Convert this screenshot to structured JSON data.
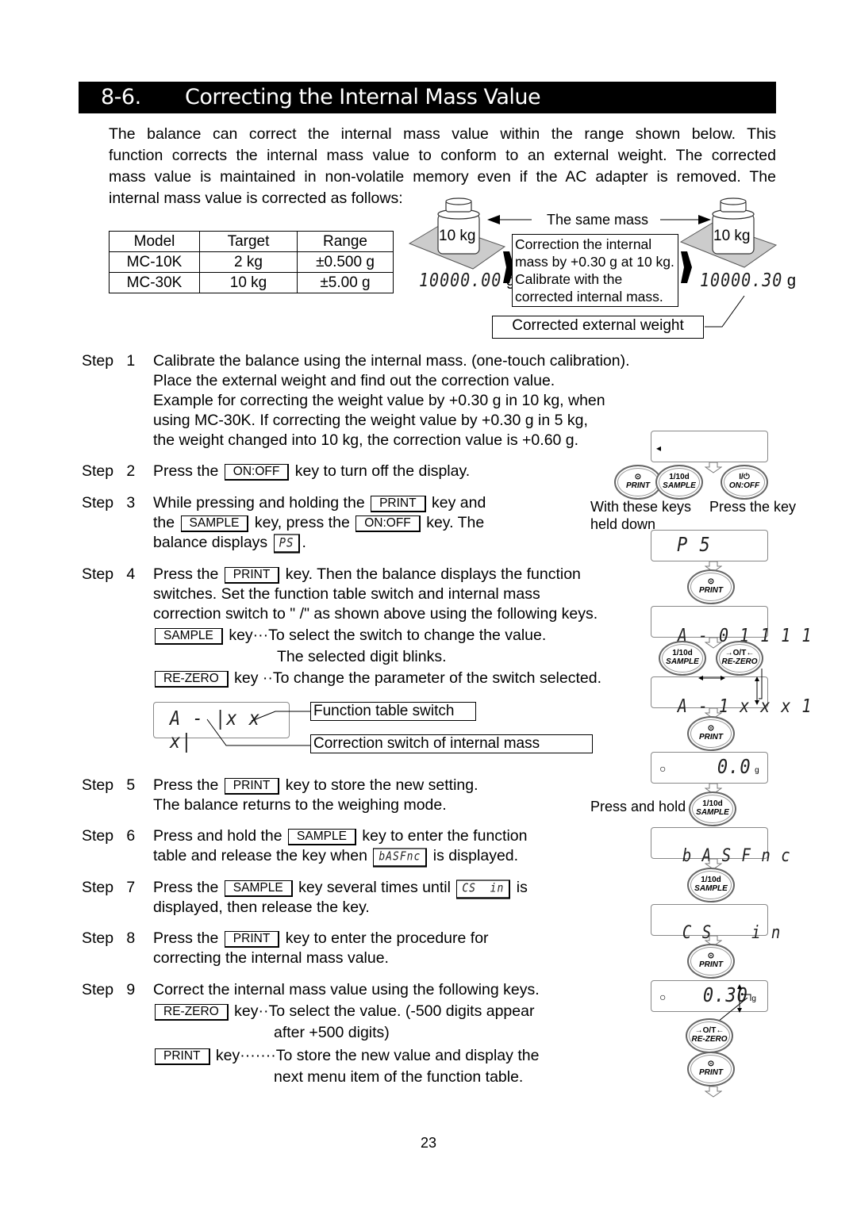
{
  "section": {
    "number": "8-6.",
    "title": "Correcting the Internal Mass Value"
  },
  "intro": {
    "line1": "The balance can correct the internal mass value within the range shown below. This",
    "line2": "function corrects the internal mass value to conform to an external weight. The corrected",
    "line3": "mass value is maintained in non-volatile memory even if the AC adapter is removed. The",
    "line4": "internal mass value is corrected as follows:"
  },
  "model_table": {
    "headers": [
      "Model",
      "Target",
      "Range"
    ],
    "rows": [
      [
        "MC-10K",
        "2 kg",
        "±0.500 g"
      ],
      [
        "MC-30K",
        "10 kg",
        "±5.00 g"
      ]
    ]
  },
  "illustration": {
    "same_mass_label": "The same mass",
    "weight_left": "10 kg",
    "weight_right": "10 kg",
    "reading_before": "10000.00",
    "reading_after": "10000.30",
    "unit": "g",
    "center_note": {
      "line1": "Correction the internal",
      "line2": "mass by +0.30 g at 10 kg.",
      "line3": "Calibrate with the",
      "line4": "corrected internal mass."
    },
    "corrected_label": "Corrected external weight"
  },
  "keys": {
    "on_off": "ON:OFF",
    "print": "PRINT",
    "sample": "SAMPLE",
    "re_zero": "RE-ZERO"
  },
  "steps": {
    "step_word": "Step",
    "s1": {
      "num": "1",
      "line1": "Calibrate the balance using the internal mass. (one-touch calibration).",
      "line2": "Place the external weight and find out the correction value.",
      "line3": "Example for correcting the weight value by +0.30 g in 10 kg, when",
      "line4": "using MC-30K. If correcting the weight value by +0.30 g in 5 kg,",
      "line5": "the weight changed into 10 kg, the correction value is +0.60 g."
    },
    "s2": {
      "num": "2",
      "pre": "Press the",
      "post": "key to turn off the display."
    },
    "s3": {
      "num": "3",
      "a": "While pressing and holding the",
      "b": "key and",
      "c": "the",
      "d": "key, press the",
      "e": "key. The",
      "f": "balance displays",
      "g": ".",
      "display": "PS"
    },
    "s4": {
      "num": "4",
      "a": "Press the",
      "b": "key. Then the balance displays the function",
      "line2": "switches. Set the function table switch and internal mass",
      "line3": "correction switch to \" /\" as shown above using the following keys.",
      "sample_desc": "key···To select the switch to change the value.",
      "sample_desc2": "The selected digit blinks.",
      "rezero_desc": "key ··To change the parameter of the switch selected.",
      "diagram_display": "A - |x x x|",
      "function_table_switch": "Function table switch",
      "correction_switch": "Correction switch of internal mass"
    },
    "s5": {
      "num": "5",
      "a": "Press the",
      "b": "key to store the new setting.",
      "line2": "The balance returns to the weighing mode."
    },
    "s6": {
      "num": "6",
      "a": "Press and hold the",
      "b": "key to enter the function",
      "c": "table and release the key when",
      "d": "is displayed.",
      "display": "bASFnc"
    },
    "s7": {
      "num": "7",
      "a": "Press the",
      "b": "key several times until",
      "c": "is",
      "line2": "displayed, then release the key.",
      "display": "CS  in"
    },
    "s8": {
      "num": "8",
      "a": "Press the",
      "b": "key to enter the procedure for",
      "line2": "correcting the internal mass value."
    },
    "s9": {
      "num": "9",
      "line1": "Correct the internal mass value using the following keys.",
      "rezero_desc": "key··To select the value. (-500 digits appear",
      "rezero_desc2": "after +500 digits)",
      "print_desc": "key·······To store the new value and display the",
      "print_desc2": "next menu item of the function table."
    }
  },
  "side_flow": {
    "display_off": "◂",
    "display_ps": "P 5",
    "display_a01111": "A - 0 1 1 1 1",
    "display_a1xxx1": "A - 1 x x x 1",
    "display_zero": "0.0",
    "display_basfnc": "b A S F n c",
    "display_csin": "C S    i n",
    "display_030": "0.30",
    "unit_g": "g",
    "with_these_keys": "With these keys",
    "held_down": "held down",
    "press_the_key": "Press the key",
    "press_and_hold": "Press and hold",
    "key_print_top": "⊙",
    "key_print": "PRINT",
    "key_sample_top": "1/10d",
    "key_sample": "SAMPLE",
    "key_onoff_top": "I/⏻",
    "key_onoff": "ON:OFF",
    "key_rezero_top": "→O/T←",
    "key_rezero": "RE-ZERO"
  },
  "page_number": "23"
}
